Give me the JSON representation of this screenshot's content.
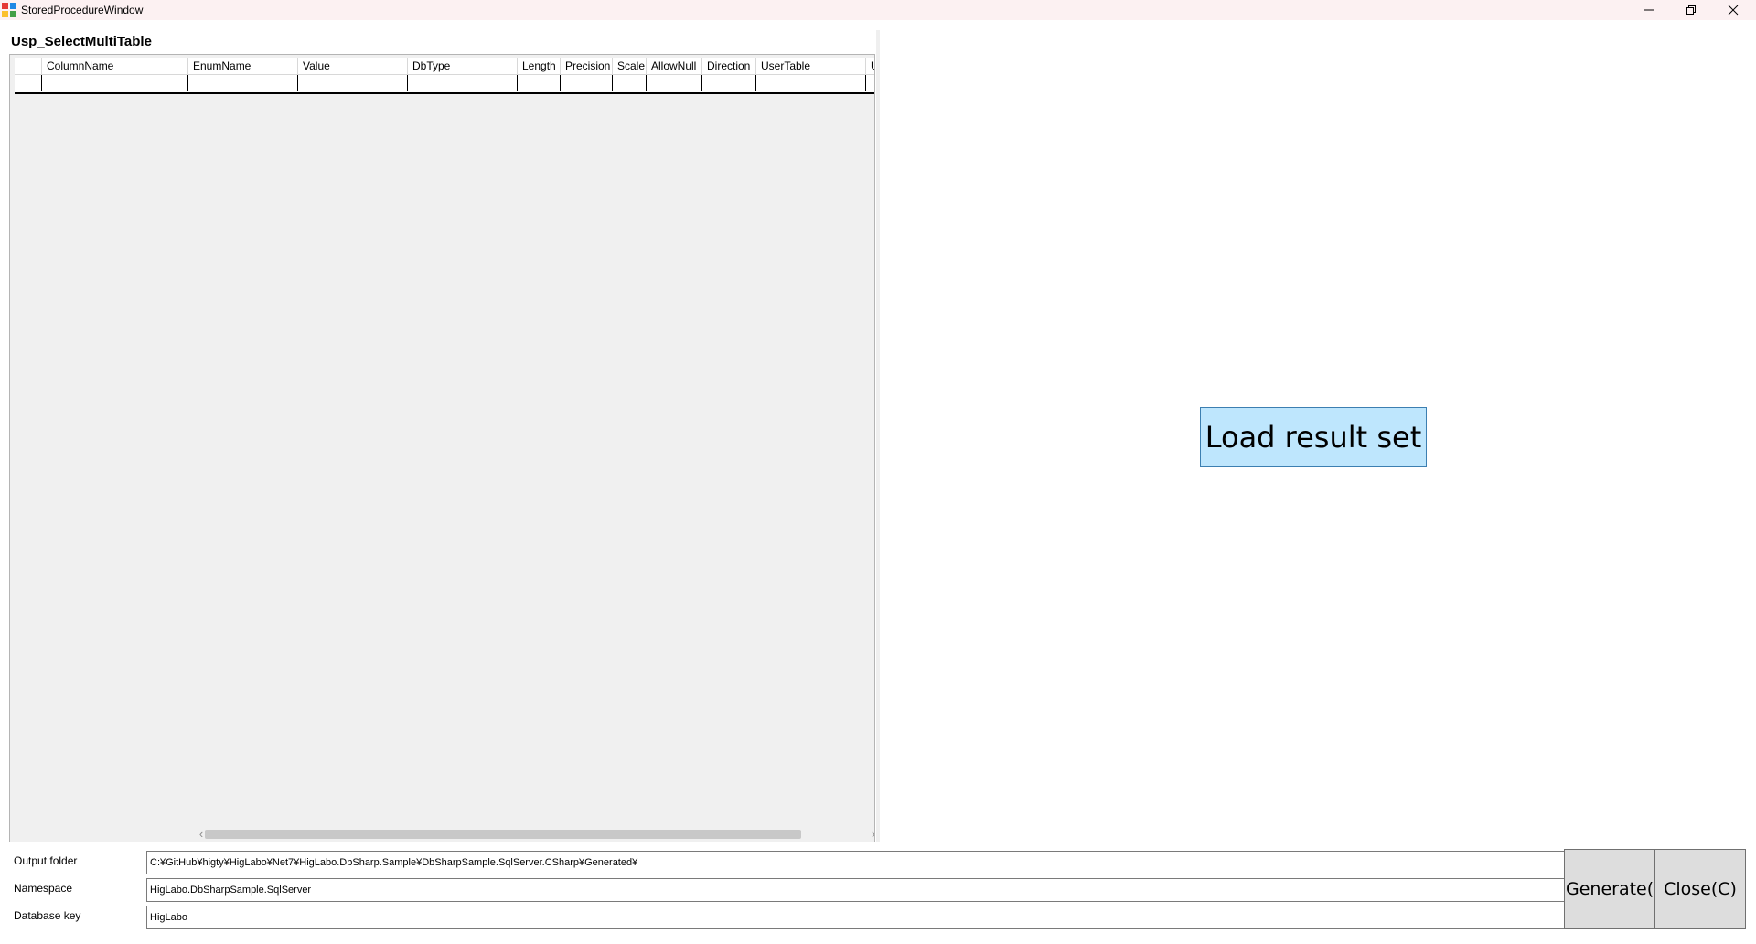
{
  "window": {
    "title": "StoredProcedureWindow",
    "controls": {
      "minimize_icon": "minimize-icon",
      "maximize_icon": "restore-icon",
      "close_icon": "close-icon"
    }
  },
  "procedure": {
    "name": "Usp_SelectMultiTable"
  },
  "grid": {
    "columns": [
      "",
      "ColumnName",
      "EnumName",
      "Value",
      "DbType",
      "Length",
      "Precision",
      "Scale",
      "AllowNull",
      "Direction",
      "UserTable",
      "U"
    ],
    "rows": [
      [
        "",
        "",
        "",
        "",
        "",
        "",
        "",
        "",
        "",
        "",
        "",
        ""
      ]
    ]
  },
  "result_set": {
    "load_label": "Load result set"
  },
  "form": {
    "output_folder_label": "Output folder",
    "output_folder_value": "C:¥GitHub¥higty¥HigLabo¥Net7¥HigLabo.DbSharp.Sample¥DbSharpSample.SqlServer.CSharp¥Generated¥",
    "namespace_label": "Namespace",
    "namespace_value": "HigLabo.DbSharpSample.SqlServer",
    "database_key_label": "Database key",
    "database_key_value": "HigLabo"
  },
  "actions": {
    "generate_label": "Generate(C",
    "close_label": "Close(C)"
  },
  "colors": {
    "titlebar_bg": "#fcf1f2",
    "load_button_bg": "#bee6fd",
    "load_button_border": "#3c7fb1",
    "action_button_bg": "#dddddd"
  }
}
